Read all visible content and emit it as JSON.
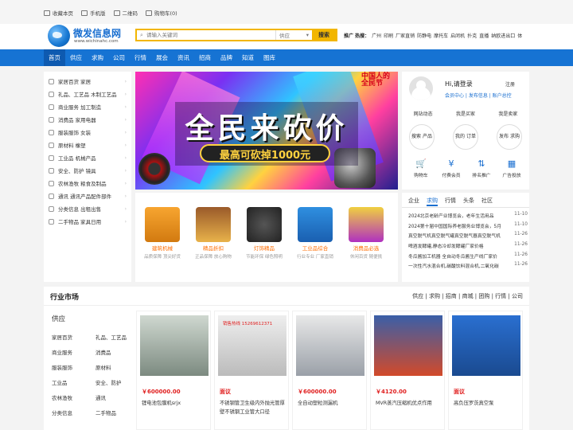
{
  "topbar": {
    "items": [
      "收藏本页",
      "手机版",
      "二维码",
      "购物车(0)"
    ]
  },
  "logo": {
    "name": "微发信息网",
    "url": "www.wichinahc.com"
  },
  "search": {
    "placeholder": "请输入关键词",
    "category": "供应",
    "button": "搜索"
  },
  "hot": {
    "label": "推广 热搜：",
    "terms": [
      "广州",
      "印刷",
      "厂家直销",
      "防静电",
      "摩托车",
      "启闭机",
      "扑克",
      "直播",
      "纳欧进出口",
      "体"
    ]
  },
  "nav": [
    "首页",
    "供应",
    "求购",
    "公司",
    "行情",
    "展会",
    "资讯",
    "招商",
    "品牌",
    "知道",
    "图库"
  ],
  "categories": [
    "家居百货 家居",
    "礼品、工艺品 木制工艺品",
    "商业服务 加工制造",
    "消费品 家用电器",
    "服装服饰 女装",
    "原材料 橡塑",
    "工业品 机械产品",
    "安全、防护 镜具",
    "农林渔牧 粮食及制品",
    "通讯 通讯产品配件部件",
    "分类信息 出租出售",
    "二手物品 家具日用"
  ],
  "banner": {
    "headline": "全民来砍价",
    "subline": "最高可砍掉1000元",
    "stamp": "中国人的 全民节"
  },
  "user": {
    "greeting": "Hi,请登录",
    "register": "注册",
    "links": "会员中心 | 发布信息 | 账户总控",
    "tabs": [
      "网站动态",
      "我是买家",
      "我是卖家"
    ],
    "circles": [
      "搜索 产品",
      "我的 订单",
      "发布 求购"
    ],
    "quick": [
      {
        "icon": "🛒",
        "label": "购物车"
      },
      {
        "icon": "¥",
        "label": "付费会员"
      },
      {
        "icon": "⇅",
        "label": "排名推广"
      },
      {
        "icon": "▦",
        "label": "广告投放"
      }
    ]
  },
  "products": [
    {
      "name": "建筑机械",
      "sub": "品质保障 顶尖好货"
    },
    {
      "name": "精品折扣",
      "sub": "正品保障 放心购物"
    },
    {
      "name": "灯饰精品",
      "sub": "节能环保 绿色照明"
    },
    {
      "name": "工业品综合",
      "sub": "行业专业 厂家直销"
    },
    {
      "name": "消费品必选",
      "sub": "休闲百货 随便挑"
    }
  ],
  "news": {
    "tabs": [
      "企业",
      "求购",
      "行情",
      "头条",
      "社区"
    ],
    "items": [
      {
        "title": "2024北京老龄产业博览会，老年生活用品",
        "date": "11-10"
      },
      {
        "title": "2024第十届中国国际养老服务业博览会，5月",
        "date": "11-10"
      },
      {
        "title": "真空脱气机真空脱气罐真空脱气器真空脱气机",
        "date": "11-26"
      },
      {
        "title": "啤酒发酵罐,静态冷却发酵罐厂家价格",
        "date": "11-26"
      },
      {
        "title": "冬瓜酱加工机器 全自动冬瓜酱生产线厂家价",
        "date": "11-26"
      },
      {
        "title": "一次性汽水混合机,碳酸饮料混合机,二氧化碳",
        "date": "11-26"
      }
    ]
  },
  "market": {
    "title": "行业市场",
    "tags": "供应 | 求购 | 招商 | 商城 | 团购 | 行情 | 公司",
    "side_title": "供应",
    "side_items": [
      "家居百货",
      "礼品、工艺品",
      "商业服务",
      "消费品",
      "服装服饰",
      "原材料",
      "工业品",
      "安全、防护",
      "农林渔牧",
      "通讯",
      "分类信息",
      "二手物品"
    ],
    "cards": [
      {
        "price": "￥600000.00",
        "name": "锂电池包膜机srjx",
        "overlay": ""
      },
      {
        "price": "面议",
        "name": "不锈钢管卫生级内外抛光管厚壁不锈钢工业管大口径",
        "overlay": "销售热线 15269612371"
      },
      {
        "price": "￥600000.00",
        "name": "全自动塑粒测漏机",
        "overlay": ""
      },
      {
        "price": "￥4120.00",
        "name": "MVR蒸汽压缩机优点作用",
        "overlay": ""
      },
      {
        "price": "面议",
        "name": "高负压罗茨真空泵",
        "overlay": ""
      }
    ]
  }
}
